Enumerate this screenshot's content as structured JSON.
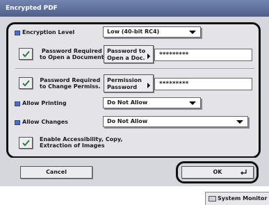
{
  "window": {
    "title": "Encrypted PDF"
  },
  "encryption_level": {
    "label": "Encryption Level",
    "value": "Low (40-bit RC4)"
  },
  "open_password": {
    "label_line1": "Password Required",
    "label_line2": "to Open a Document",
    "button_line1": "Password to",
    "button_line2": "Open a Doc.",
    "value": "*********"
  },
  "change_password": {
    "label_line1": "Password Required",
    "label_line2": "to Change Permiss.",
    "button_line1": "Permission",
    "button_line2": "Password",
    "value": "*********"
  },
  "allow_printing": {
    "label": "Allow Printing",
    "value": "Do Not Allow"
  },
  "allow_changes": {
    "label": "Allow Changes",
    "value": "Do Not Allow"
  },
  "accessibility": {
    "label_line1": "Enable Accessibility, Copy,",
    "label_line2": "Extraction of Images"
  },
  "footer": {
    "cancel_label": "Cancel",
    "ok_label": "OK"
  },
  "status_bar": {
    "system_monitor_label": "System Monitor"
  },
  "colors": {
    "title_bar": "#5a6a98",
    "bullet": "#4a6fd0",
    "panel_bg": "#e3e3e8"
  },
  "icons": {
    "checkbox": "check-icon",
    "ok": "return-arrow-icon"
  }
}
